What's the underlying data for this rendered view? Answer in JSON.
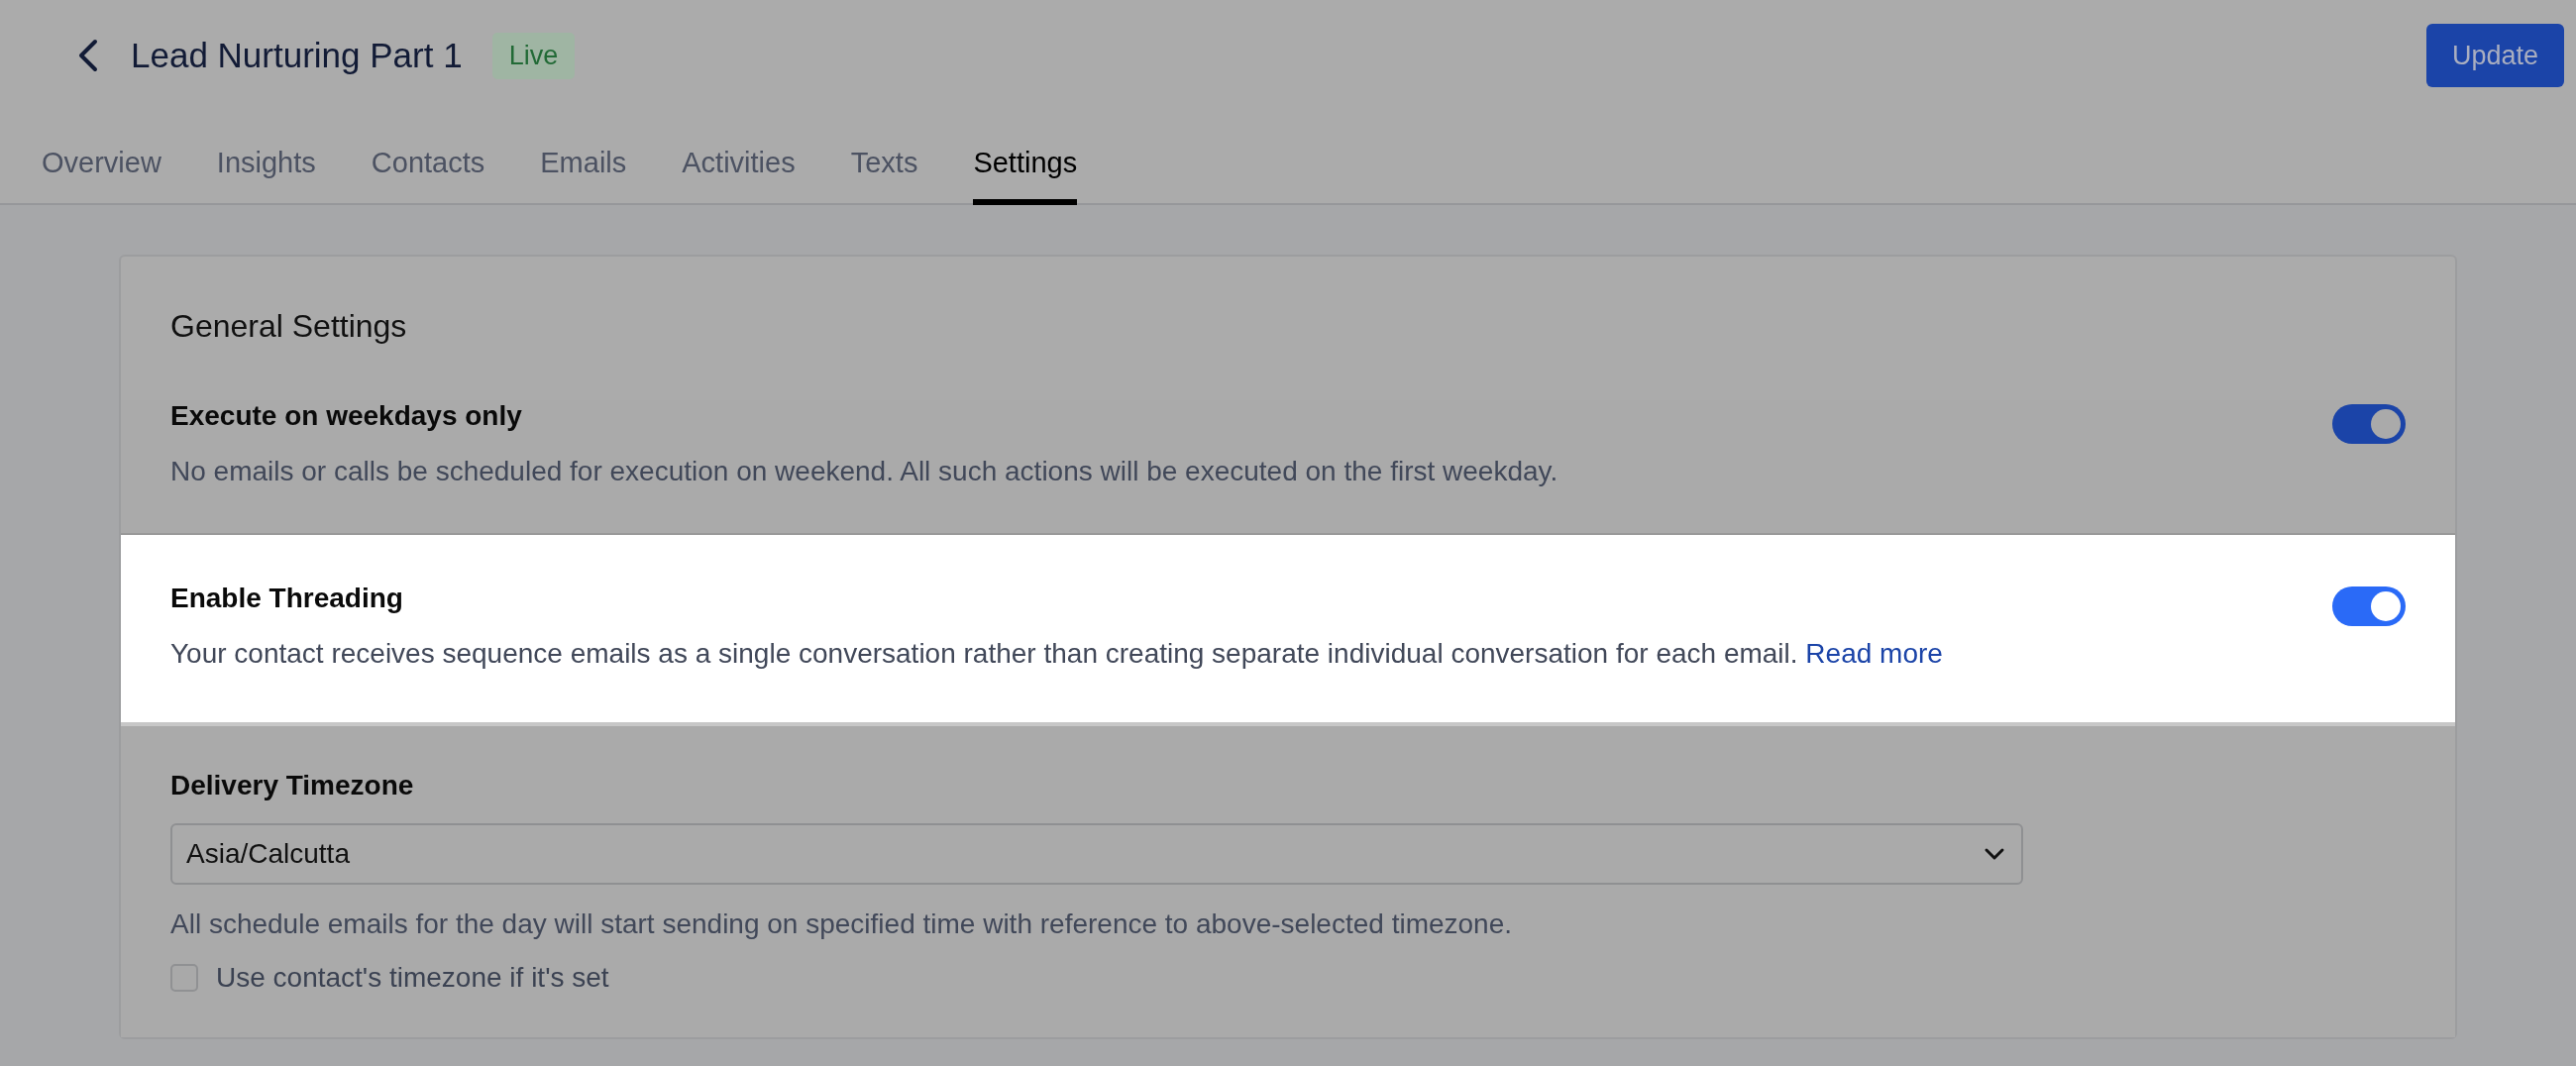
{
  "header": {
    "title": "Lead Nurturing Part 1",
    "status": "Live",
    "action": "Update"
  },
  "tabs": [
    {
      "label": "Overview",
      "selected": false
    },
    {
      "label": "Insights",
      "selected": false
    },
    {
      "label": "Contacts",
      "selected": false
    },
    {
      "label": "Emails",
      "selected": false
    },
    {
      "label": "Activities",
      "selected": false
    },
    {
      "label": "Texts",
      "selected": false
    },
    {
      "label": "Settings",
      "selected": true
    }
  ],
  "card": {
    "title": "General Settings",
    "sections": [
      {
        "kind": "toggle",
        "highlighted": false,
        "title": "Execute on weekdays only",
        "description": "No emails or calls be scheduled for execution on weekend. All such actions will be executed on the first weekday.",
        "on": true
      },
      {
        "kind": "toggle",
        "highlighted": true,
        "title": "Enable Threading",
        "description": "Your contact receives sequence emails as a single conversation rather than creating separate individual conversation for each email.",
        "link": "Read more",
        "on": true
      },
      {
        "kind": "select",
        "highlighted": false,
        "title": "Delivery Timezone",
        "value": "Asia/Calcutta",
        "description": "All schedule emails for the day will start sending on specified time with reference to above-selected timezone.",
        "checkbox": {
          "label": "Use contact's timezone if it's set",
          "checked": false
        }
      }
    ]
  }
}
